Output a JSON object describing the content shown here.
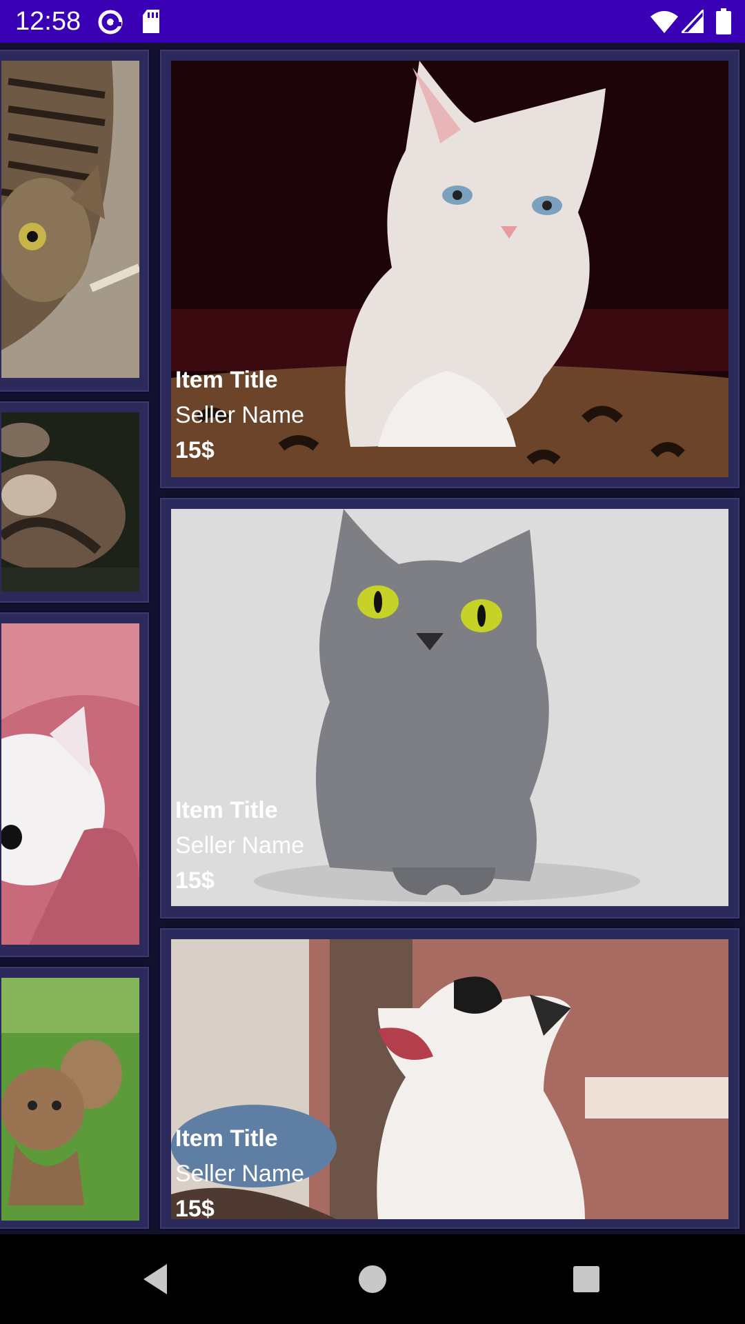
{
  "status_bar": {
    "time": "12:58"
  },
  "cards": [
    {
      "title": "Item Title",
      "seller": "Seller Name",
      "price": "15$"
    },
    {
      "title": "Item Title",
      "seller": "Seller Name",
      "price": "15$"
    },
    {
      "title": "Item Title",
      "seller": "Seller Name",
      "price": "15$"
    }
  ],
  "colors": {
    "status_bar": "#3a00b5",
    "background": "#141230",
    "card": "#2b2a5a",
    "navigation_bar": "#000000"
  },
  "icons": [
    "at-sign-icon",
    "sd-card-icon",
    "wifi-icon",
    "signal-icon",
    "battery-icon",
    "back-icon",
    "home-icon",
    "recents-icon"
  ]
}
